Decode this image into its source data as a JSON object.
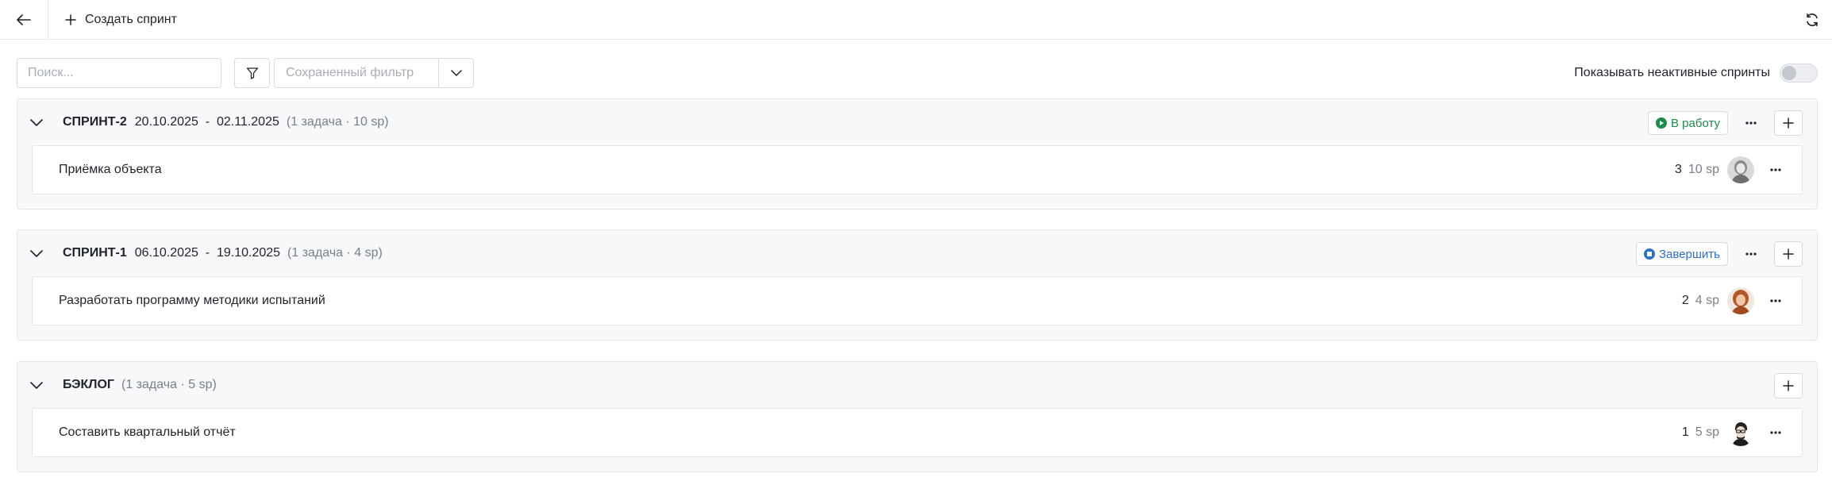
{
  "toolbar": {
    "create_label": "Создать спринт"
  },
  "filters": {
    "search_placeholder": "Поиск...",
    "saved_filter_placeholder": "Сохраненный фильтр",
    "inactive_label": "Показывать неактивные спринты",
    "inactive_enabled": false
  },
  "sprints": [
    {
      "name": "СПРИНТ-2",
      "dates": "20.10.2025  -  02.11.2025",
      "count": "(1 задача · 10 sp)",
      "action_label": "В работу",
      "action_status": "start",
      "tasks": [
        {
          "title": "Приёмка объекта",
          "num": "3",
          "sp": "10 sp",
          "avatar": "avatar-woman-grey"
        }
      ]
    },
    {
      "name": "СПРИНТ-1",
      "dates": "06.10.2025  -  19.10.2025",
      "count": "(1 задача · 4 sp)",
      "action_label": "Завершить",
      "action_status": "finish",
      "tasks": [
        {
          "title": "Разработать программу методики испытаний",
          "num": "2",
          "sp": "4 sp",
          "avatar": "avatar-woman-redhair"
        }
      ]
    },
    {
      "name": "БЭКЛОГ",
      "dates": "",
      "count": "(1 задача · 5 sp)",
      "action_label": "",
      "action_status": "",
      "tasks": [
        {
          "title": "Составить квартальный отчёт",
          "num": "1",
          "sp": "5 sp",
          "avatar": "avatar-man-glasses"
        }
      ]
    }
  ],
  "colors": {
    "start": "#1f8a4c",
    "finish": "#2f6fc4",
    "block_bg": "#f7f8fa"
  }
}
